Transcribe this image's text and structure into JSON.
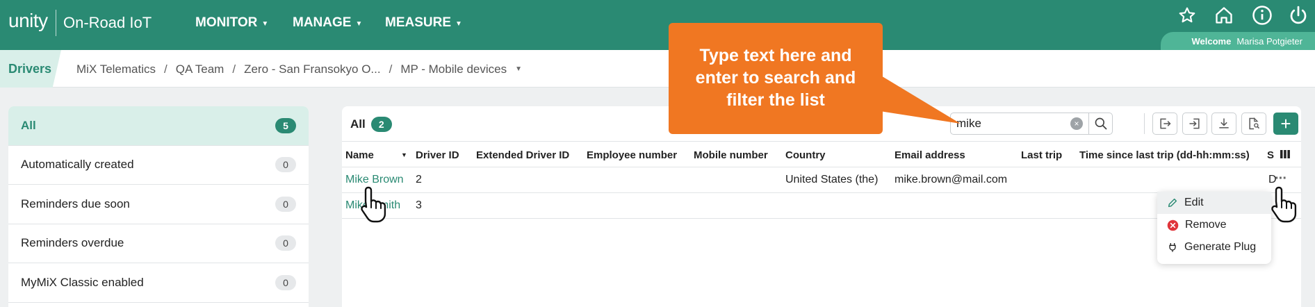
{
  "header": {
    "logo": "unity",
    "product": "On-Road IoT",
    "nav": [
      {
        "label": "MONITOR"
      },
      {
        "label": "MANAGE"
      },
      {
        "label": "MEASURE"
      }
    ],
    "welcome_label": "Welcome",
    "user_name": "Marisa Potgieter",
    "bar_color": "#2a8a73"
  },
  "breadcrumb": {
    "section": "Drivers",
    "path": [
      "MiX Telematics",
      "QA Team",
      "Zero - San Fransokyo O...",
      "MP - Mobile devices"
    ],
    "separator": "/"
  },
  "filters": [
    {
      "label": "All",
      "count": "5",
      "active": true
    },
    {
      "label": "Automatically created",
      "count": "0"
    },
    {
      "label": "Reminders due soon",
      "count": "0"
    },
    {
      "label": "Reminders overdue",
      "count": "0"
    },
    {
      "label": "MyMiX Classic enabled",
      "count": "0"
    }
  ],
  "main": {
    "title": "All",
    "count": "2",
    "search_value": "mike",
    "clear_glyph": "×",
    "add_glyph": "+"
  },
  "table": {
    "columns": [
      "Name",
      "Driver ID",
      "Extended Driver ID",
      "Employee number",
      "Mobile number",
      "Country",
      "Email address",
      "Last trip",
      "Time since last trip (dd-hh:mm:ss)",
      "S"
    ],
    "rows": [
      {
        "name": "Mike Brown",
        "driver_id": "2",
        "country": "United States (the)",
        "email": "mike.brown@mail.com",
        "time_since": "D"
      },
      {
        "name": "Mike Smith",
        "driver_id": "3"
      }
    ],
    "row_menu_glyph": "···"
  },
  "row_menu": [
    {
      "label": "Edit",
      "icon": "pencil-icon"
    },
    {
      "label": "Remove",
      "icon": "remove-circle-icon"
    },
    {
      "label": "Generate Plug",
      "icon": "plug-icon"
    }
  ],
  "callout": {
    "lines": [
      "Type text here and",
      "enter to search and",
      "filter the list"
    ],
    "color": "#f07722"
  }
}
